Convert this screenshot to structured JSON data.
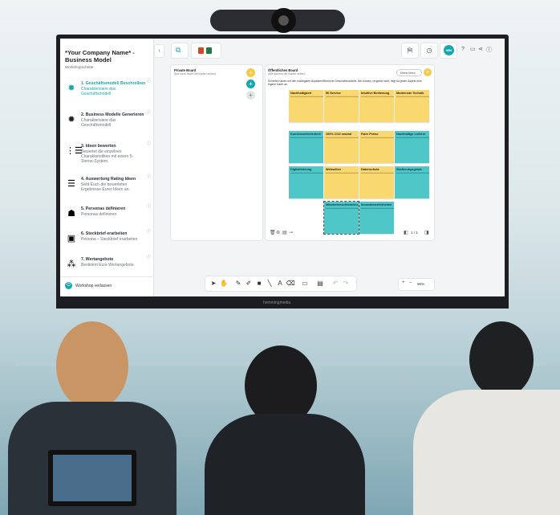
{
  "sidebar": {
    "title": "*Your Company Name* - Business Model",
    "subtitle": "Workshopschritte",
    "steps": [
      {
        "title": "1. Geschäftsmodell Beschreiben",
        "desc": "Charakterisiere das Geschäftsmodell",
        "icon": "lightbulb-icon"
      },
      {
        "title": "2. Business Modelle Generieren",
        "desc": "Charakterisiere das Geschäftsmodell",
        "icon": "lightbulb-icon"
      },
      {
        "title": "3. Ideen bewerten",
        "desc": "Bewertet die einzelnen Charakteristiken mit einem 5-Sterne-System.",
        "icon": "rating-icon"
      },
      {
        "title": "4. Auswertung Rating Ideen",
        "desc": "Seht Euch die bewerteten Ergebnisse Eurer Ideen an.",
        "icon": "list-icon"
      },
      {
        "title": "5. Personas definieren",
        "desc": "Personas definieren",
        "icon": "person-icon"
      },
      {
        "title": "6. Steckbrief erarbeiten",
        "desc": "Persona – Steckbrief erarbeiten",
        "icon": "profile-card-icon"
      },
      {
        "title": "7. Wertangebote",
        "desc": "Bestimmt Eure Wertangebote.",
        "icon": "team-icon"
      }
    ],
    "leave_label": "Workshop verlassen"
  },
  "top": {
    "avatar_initials": "MM",
    "help": "?"
  },
  "private_board": {
    "title": "Private Board",
    "subtitle": "(Nur sieht Ihnen die Karten sehen)"
  },
  "public_board": {
    "title": "Öffentliches Board",
    "subtitle": "(Alle können die Karten sehen)",
    "toggle_label": "Meine Ideen",
    "instruction": "Schreibt Karten mit den wichtigsten Aspekten/Bereiche Geschäftsmodells. Bei Kreativ, vergesst nicht, liegt für jeden Aspekt eine eigene Karte an.",
    "page": "1 / 1"
  },
  "notes": [
    {
      "title": "Nachhaltigkeit",
      "color": "yellow"
    },
    {
      "title": "5€ Service",
      "color": "yellow"
    },
    {
      "title": "Intuitive Bedienung",
      "color": "yellow"
    },
    {
      "title": "Modernste Technik",
      "color": "yellow"
    },
    {
      "title": "Kundenzufriedenheit",
      "color": "yellow"
    },
    {
      "title": "100% CO2 neutral",
      "color": "yellow"
    },
    {
      "title": "Faire Preise",
      "color": "yellow"
    },
    {
      "title": "Nachhaltige Lieferer",
      "color": "cyan"
    },
    {
      "title": "Digitalisierung",
      "color": "cyan"
    },
    {
      "title": "Webseiten",
      "color": "yellow"
    },
    {
      "title": "Datenschutz",
      "color": "yellow"
    },
    {
      "title": "Skalierungsgrade",
      "color": "cyan"
    },
    {
      "title": "Mitarbeiterzufriedenheit",
      "color": "cyan"
    },
    {
      "title": "Innovationsfreiheiten",
      "color": "cyan"
    }
  ],
  "toolbar": {
    "zoom": "96%"
  },
  "display": {
    "brand": "hemmingmedia"
  }
}
